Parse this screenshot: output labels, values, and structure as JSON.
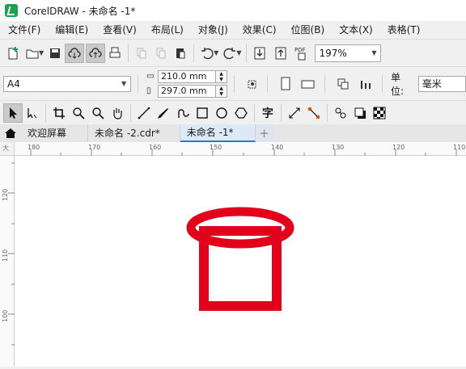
{
  "window": {
    "title": "CorelDRAW - 未命名 -1*"
  },
  "menu": [
    "文件(F)",
    "编辑(E)",
    "查看(V)",
    "布局(L)",
    "对象(J)",
    "效果(C)",
    "位图(B)",
    "文本(X)",
    "表格(T)"
  ],
  "toolbar": {
    "zoom_value": "197%",
    "icons": [
      "new-document-icon",
      "open-folder-icon",
      "save-icon",
      "cloud-download-icon",
      "cloud-upload-icon",
      "print-icon",
      "cut-icon",
      "copy-icon",
      "paste-icon",
      "undo-icon",
      "redo-icon",
      "import-icon",
      "export-icon",
      "pdf-icon"
    ],
    "pdf_label": "PDF"
  },
  "property_bar": {
    "page_size": "A4",
    "width": "210.0 mm",
    "height": "297.0 mm",
    "unit_label": "单位:",
    "unit_value": "毫米"
  },
  "tools": {
    "text_tool_glyph": "字"
  },
  "tabs": {
    "items": [
      "欢迎屏幕",
      "未命名 -2.cdr*",
      "未命名 -1*"
    ],
    "active_index": 2,
    "add_label": "+"
  },
  "rulers": {
    "horizontal": [
      "180",
      "170",
      "160",
      "150",
      "140",
      "130",
      "120",
      "110"
    ],
    "vertical": [
      "120",
      "110",
      "100"
    ],
    "corner": "大"
  },
  "drawing": {
    "stroke_color": "#e2001a"
  }
}
